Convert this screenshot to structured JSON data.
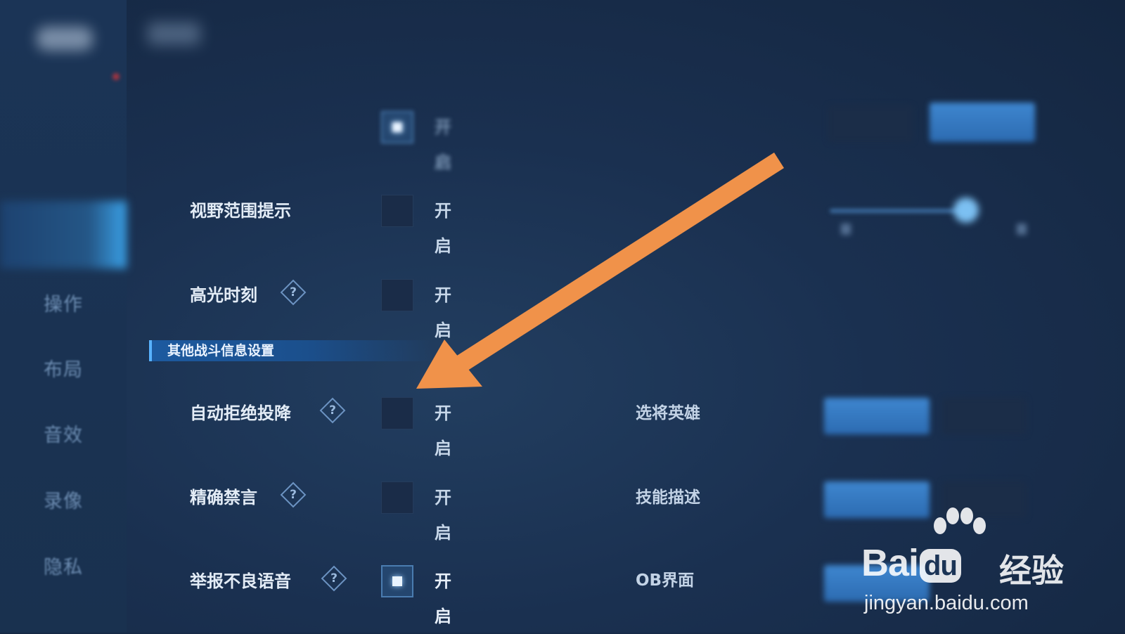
{
  "sidebar": {
    "items": [
      {
        "label": "",
        "faded": true
      },
      {
        "label": "",
        "faded": true
      },
      {
        "label": "",
        "faded": true,
        "active": true
      },
      {
        "label": "操作"
      },
      {
        "label": "布局"
      },
      {
        "label": "音效"
      },
      {
        "label": "录像"
      },
      {
        "label": "隐私"
      }
    ]
  },
  "settings": {
    "on_text": "开启",
    "rows": [
      {
        "label": "",
        "checked": true,
        "blurred": true
      },
      {
        "label": "视野范围提示",
        "checked": false
      },
      {
        "label": "高光时刻",
        "checked": false,
        "help": true
      },
      {
        "label": "自动拒绝投降",
        "checked": false,
        "help": true
      },
      {
        "label": "精确禁言",
        "checked": false,
        "help": true
      },
      {
        "label": "举报不良语音",
        "checked": true,
        "help": true
      }
    ]
  },
  "section": {
    "title": "其他战斗信息设置"
  },
  "right_panel": {
    "labels": [
      {
        "sharp": "选将英雄"
      },
      {
        "sharp": "技能描述"
      },
      {
        "sharp": "OB界面"
      }
    ]
  },
  "watermark": {
    "brand_left": "Bai",
    "brand_du": "du",
    "brand_cn": "经验",
    "url": "jingyan.baidu.com"
  },
  "colors": {
    "arrow": "#f0924a",
    "accent": "#58b2ff",
    "checkbox_on": "#4a7cb0"
  }
}
